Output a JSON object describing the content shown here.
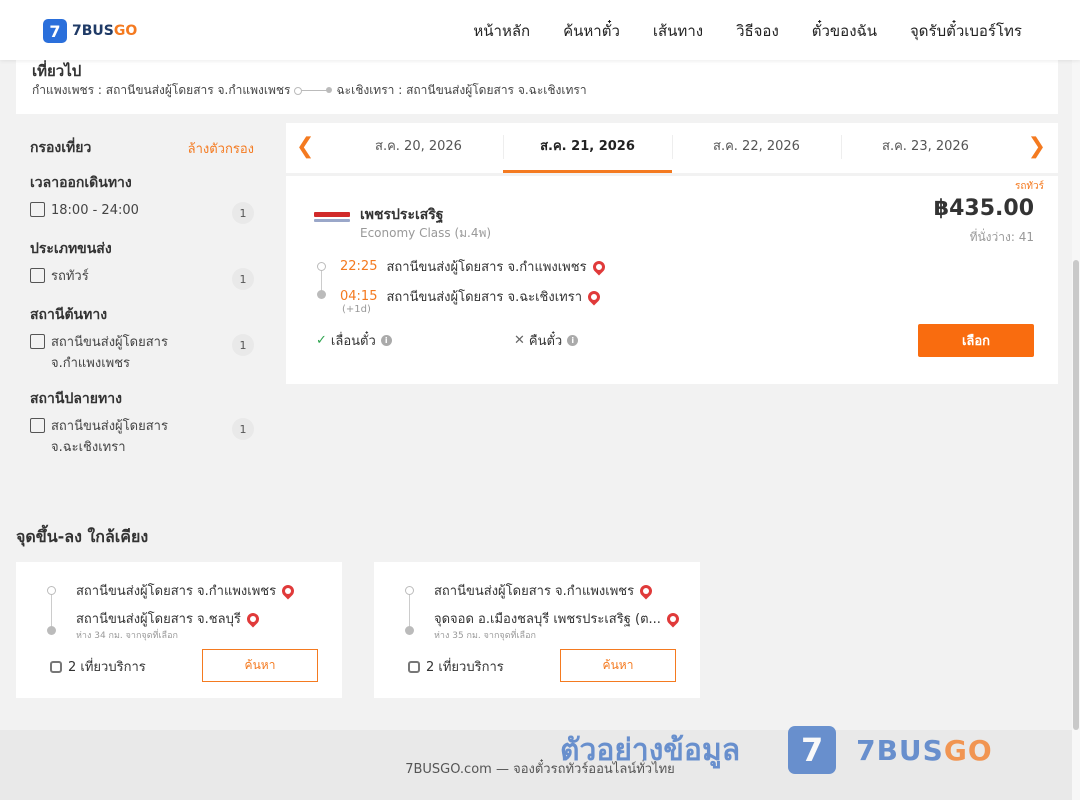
{
  "brand": {
    "badge": "7",
    "name_a": "7BUS",
    "name_b": "GO"
  },
  "nav": [
    "หน้าหลัก",
    "ค้นหาตั๋ว",
    "เส้นทาง",
    "วิธีจอง",
    "ตั๋วของฉัน",
    "จุดรับตั๋วเบอร์โทร"
  ],
  "trip": {
    "title": "เที่ยวไป",
    "from": "กำแพงเพชร : สถานีขนส่งผู้โดยสาร จ.กำแพงเพชร",
    "to": "ฉะเชิงเทรา : สถานีขนส่งผู้โดยสาร จ.ฉะเชิงเทรา"
  },
  "filter": {
    "title": "กรองเที่ยว",
    "clear": "ล้างตัวกรอง",
    "groups": [
      {
        "title": "เวลาออกเดินทาง",
        "options": [
          {
            "label": "18:00 - 24:00",
            "count": "1"
          }
        ]
      },
      {
        "title": "ประเภทขนส่ง",
        "options": [
          {
            "label": "รถทัวร์",
            "count": "1"
          }
        ]
      },
      {
        "title": "สถานีต้นทาง",
        "options": [
          {
            "label": "สถานีขนส่งผู้โดยสาร จ.กำแพงเพชร",
            "count": "1"
          }
        ]
      },
      {
        "title": "สถานีปลายทาง",
        "options": [
          {
            "label": "สถานีขนส่งผู้โดยสาร จ.ฉะเชิงเทรา",
            "count": "1"
          }
        ]
      }
    ]
  },
  "dates": [
    "ส.ค. 20, 2026",
    "ส.ค. 21, 2026",
    "ส.ค. 22, 2026",
    "ส.ค. 23, 2026"
  ],
  "active_date_index": 1,
  "result": {
    "tag": "รถทัวร์",
    "operator": "เพชรประเสริฐ",
    "class": "Economy Class (ม.4พ)",
    "price": "฿435.00",
    "seats": "ที่นั่งว่าง: 41",
    "depart_time": "22:25",
    "depart_station": "สถานีขนส่งผู้โดยสาร จ.กำแพงเพชร",
    "arrive_time": "04:15",
    "arrive_station": "สถานีขนส่งผู้โดยสาร จ.ฉะเชิงเทรา",
    "next_day": "(+1d)",
    "reschedule": "เลื่อนตั๋ว",
    "refund": "คืนตั๋ว",
    "select": "เลือก"
  },
  "nearby": {
    "title": "จุดขึ้น-ลง ใกล้เคียง",
    "cards": [
      {
        "from": "สถานีขนส่งผู้โดยสาร จ.กำแพงเพชร",
        "to": "สถานีขนส่งผู้โดยสาร จ.ชลบุรี",
        "distance": "ห่าง 34 กม. จากจุดที่เลือก",
        "trips": "2 เที่ยวบริการ",
        "search": "ค้นหา"
      },
      {
        "from": "สถานีขนส่งผู้โดยสาร จ.กำแพงเพชร",
        "to": "จุดจอด อ.เมืองชลบุรี เพชรประเสริฐ (ต...",
        "distance": "ห่าง 35 กม. จากจุดที่เลือก",
        "trips": "2 เที่ยวบริการ",
        "search": "ค้นหา"
      }
    ]
  },
  "footer": "7BUSGO.com — จองตั๋วรถทัวร์ออนไลน์ทั่วไทย",
  "watermark": {
    "text": "ตัวอย่างข้อมูล",
    "badge": "7",
    "brand_a": "7BUS",
    "brand_b": "GO"
  },
  "colors": {
    "accent": "#f47a20",
    "button": "#f96c0f",
    "brand_blue": "#2a6fdb",
    "price": "#333333"
  }
}
